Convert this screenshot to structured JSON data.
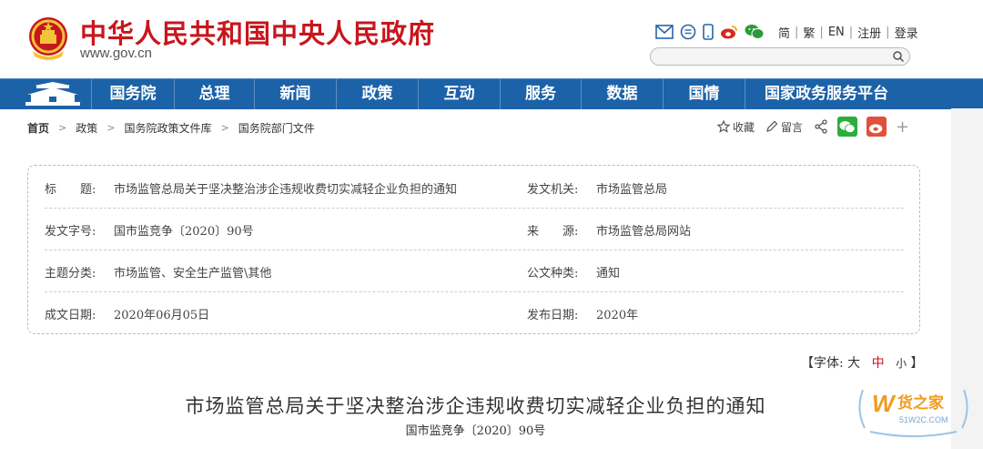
{
  "header": {
    "site_title": "中华人民共和国中央人民政府",
    "site_url": "www.gov.cn",
    "lang_links": [
      "简",
      "繁",
      "EN",
      "注册",
      "登录"
    ],
    "icons": [
      "mail-icon",
      "chat-bubble-icon",
      "mobile-icon",
      "weibo-icon",
      "wechat-icon"
    ],
    "search_placeholder": ""
  },
  "nav": {
    "items": [
      "国务院",
      "总理",
      "新闻",
      "政策",
      "互动",
      "服务",
      "数据",
      "国情",
      "国家政务服务平台"
    ]
  },
  "breadcrumb": [
    "首页",
    "政策",
    "国务院政策文件库",
    "国务院部门文件"
  ],
  "tools": {
    "favorite": "收藏",
    "comment": "留言"
  },
  "info": {
    "title_label": "标　　题:",
    "title_value": "市场监管总局关于坚决整治涉企违规收费切实减轻企业负担的通知",
    "issuer_label": "发文机关:",
    "issuer_value": "市场监管总局",
    "docno_label": "发文字号:",
    "docno_value": "国市监竞争〔2020〕90号",
    "source_label": "来　　源:",
    "source_value": "市场监管总局网站",
    "topic_label": "主题分类:",
    "topic_value": "市场监管、安全生产监管\\其他",
    "doctype_label": "公文种类:",
    "doctype_value": "通知",
    "written_label": "成文日期:",
    "written_value": "2020年06月05日",
    "published_label": "发布日期:",
    "published_value": "2020年"
  },
  "fontsize": {
    "open": "【字体:",
    "large": "大",
    "medium": "中",
    "small": "小",
    "close": "】"
  },
  "document": {
    "title": "市场监管总局关于坚决整治涉企违规收费切实减轻企业负担的通知",
    "number": "国市监竞争〔2020〕90号"
  },
  "watermark": {
    "brand": "货之家",
    "url": "51W2C.COM"
  },
  "colors": {
    "brand_red": "#c8161d",
    "nav_blue": "#1c62a8"
  }
}
